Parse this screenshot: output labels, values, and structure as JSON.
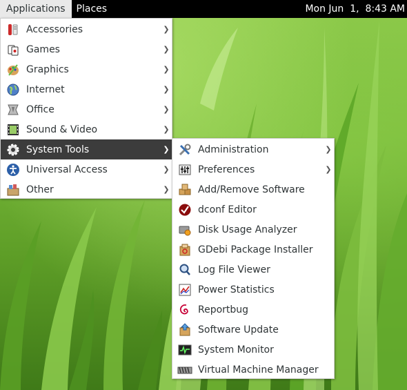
{
  "panel": {
    "applications_label": "Applications",
    "places_label": "Places",
    "clock": "Mon Jun  1,  8:43 AM"
  },
  "applications_menu": {
    "items": [
      {
        "label": "Accessories",
        "icon": "accessories-icon"
      },
      {
        "label": "Games",
        "icon": "games-icon"
      },
      {
        "label": "Graphics",
        "icon": "graphics-icon"
      },
      {
        "label": "Internet",
        "icon": "internet-icon"
      },
      {
        "label": "Office",
        "icon": "office-icon"
      },
      {
        "label": "Sound & Video",
        "icon": "sound-video-icon"
      },
      {
        "label": "System Tools",
        "icon": "system-tools-icon",
        "selected": true
      },
      {
        "label": "Universal Access",
        "icon": "universal-access-icon"
      },
      {
        "label": "Other",
        "icon": "other-icon"
      }
    ]
  },
  "system_tools_menu": {
    "items": [
      {
        "label": "Administration",
        "icon": "administration-icon",
        "submenu": true
      },
      {
        "label": "Preferences",
        "icon": "preferences-icon",
        "submenu": true
      },
      {
        "label": "Add/Remove Software",
        "icon": "package-icon"
      },
      {
        "label": "dconf Editor",
        "icon": "dconf-editor-icon"
      },
      {
        "label": "Disk Usage Analyzer",
        "icon": "disk-usage-icon"
      },
      {
        "label": "GDebi Package Installer",
        "icon": "gdebi-icon"
      },
      {
        "label": "Log File Viewer",
        "icon": "log-viewer-icon"
      },
      {
        "label": "Power Statistics",
        "icon": "power-statistics-icon"
      },
      {
        "label": "Reportbug",
        "icon": "debian-swirl-icon"
      },
      {
        "label": "Software Update",
        "icon": "software-update-icon"
      },
      {
        "label": "System Monitor",
        "icon": "system-monitor-icon"
      },
      {
        "label": "Virtual Machine Manager",
        "icon": "virtual-machine-icon"
      }
    ]
  },
  "colors": {
    "panel_bg": "#000000",
    "menu_bg": "#ffffff",
    "selected_bg": "#3c3c3c",
    "wallpaper": "#78b93a"
  }
}
